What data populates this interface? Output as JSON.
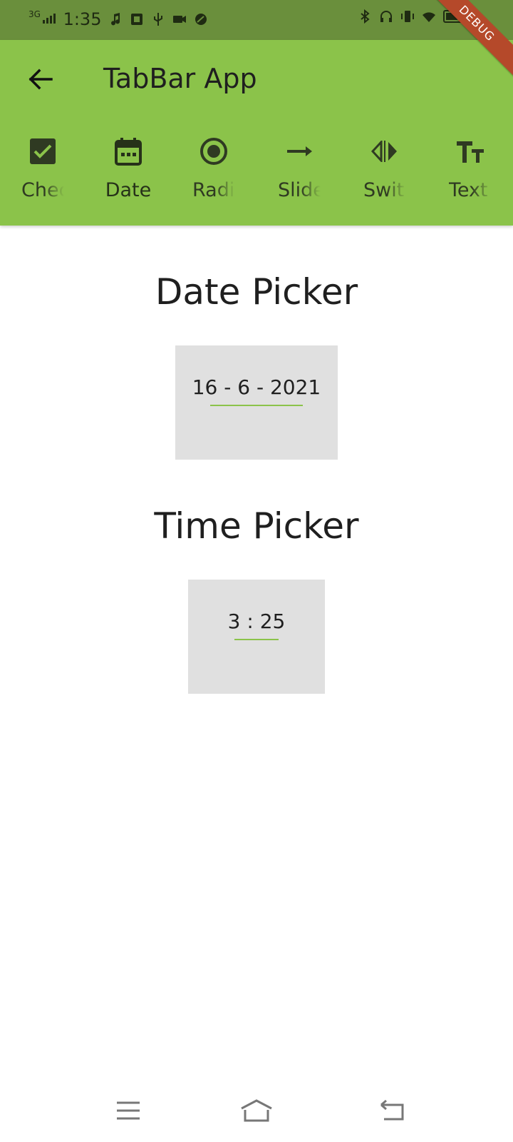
{
  "status_bar": {
    "network": "3G",
    "time": "1:35",
    "battery_level": 0.52
  },
  "app_bar": {
    "title": "TabBar App",
    "background": "#8bc34a"
  },
  "tabs": [
    {
      "label": "Chec",
      "icon": "checkbox-icon",
      "active": false
    },
    {
      "label": "Date",
      "icon": "calendar-icon",
      "active": true
    },
    {
      "label": "Radi",
      "icon": "radio-icon",
      "active": false
    },
    {
      "label": "Slide",
      "icon": "arrow-right-icon",
      "active": false
    },
    {
      "label": "Swit",
      "icon": "switch-icon",
      "active": false
    },
    {
      "label": "Text",
      "icon": "text-fields-icon",
      "active": false
    }
  ],
  "debug_banner": "DEBUG",
  "date_section": {
    "title": "Date Picker",
    "value": "16 - 6 - 2021"
  },
  "time_section": {
    "title": "Time Picker",
    "value": "3 : 25"
  },
  "colors": {
    "primary": "#8bc34a",
    "status_bar": "#6a8f3c",
    "picker_background": "#e0e0e0",
    "debug_banner": "#b5492a"
  }
}
